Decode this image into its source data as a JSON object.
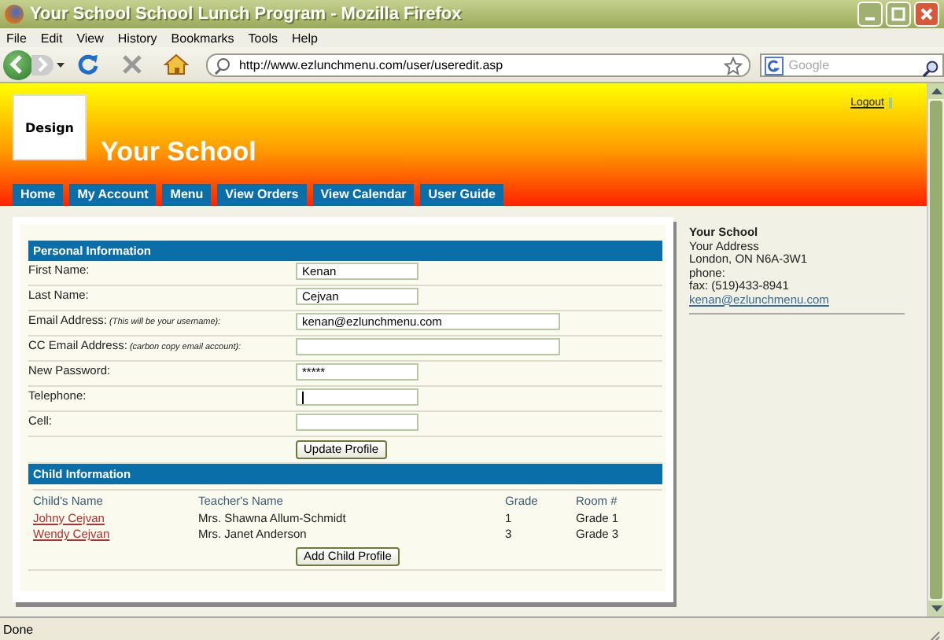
{
  "window": {
    "title": "Your School School Lunch Program - Mozilla Firefox"
  },
  "menu_bar": [
    "File",
    "Edit",
    "View",
    "History",
    "Bookmarks",
    "Tools",
    "Help"
  ],
  "toolbar": {
    "url": "http://www.ezlunchmenu.com/user/useredit.asp",
    "search": {
      "placeholder": "Google"
    }
  },
  "header": {
    "logo_text": "Design",
    "school_name": "Your School",
    "logout": "Logout"
  },
  "nav": [
    "Home",
    "My Account",
    "Menu",
    "View Orders",
    "View Calendar",
    "User Guide"
  ],
  "personal": {
    "title": "Personal Information",
    "fields": [
      {
        "label": "First Name:",
        "value": "Kenan",
        "wide": false,
        "focused": false
      },
      {
        "label": "Last Name:",
        "value": "Cejvan",
        "wide": false,
        "focused": false
      },
      {
        "label": "Email Address:",
        "note": "(This will be your username):",
        "value": "kenan@ezlunchmenu.com",
        "wide": true,
        "focused": false
      },
      {
        "label": "CC Email Address:",
        "note": "(carbon copy email account):",
        "wide": true,
        "focused": false
      },
      {
        "label": "New Password:",
        "value": "*****",
        "wide": false,
        "focused": false
      },
      {
        "label": "Telephone:",
        "wide": false,
        "focused": true
      },
      {
        "label": "Cell:",
        "wide": false,
        "focused": false
      }
    ],
    "button": "Update Profile"
  },
  "child": {
    "title": "Child Information",
    "columns": [
      "Child's Name",
      "Teacher's Name",
      "Grade",
      "Room #"
    ],
    "rows": [
      [
        "Johny Cejvan",
        "Mrs. Shawna Allum-Schmidt",
        "1",
        "Grade 1"
      ],
      [
        "Wendy  Cejvan",
        "Mrs. Janet Anderson",
        "3",
        "Grade 3"
      ]
    ],
    "button": "Add Child Profile"
  },
  "sidebar": {
    "name": "Your School",
    "lines": [
      "Your Address",
      "London, ON N6A-3W1",
      "phone:",
      "fax: (519)433-8941"
    ],
    "email": "kenan@ezlunchmenu.com"
  },
  "status_bar": "Done"
}
